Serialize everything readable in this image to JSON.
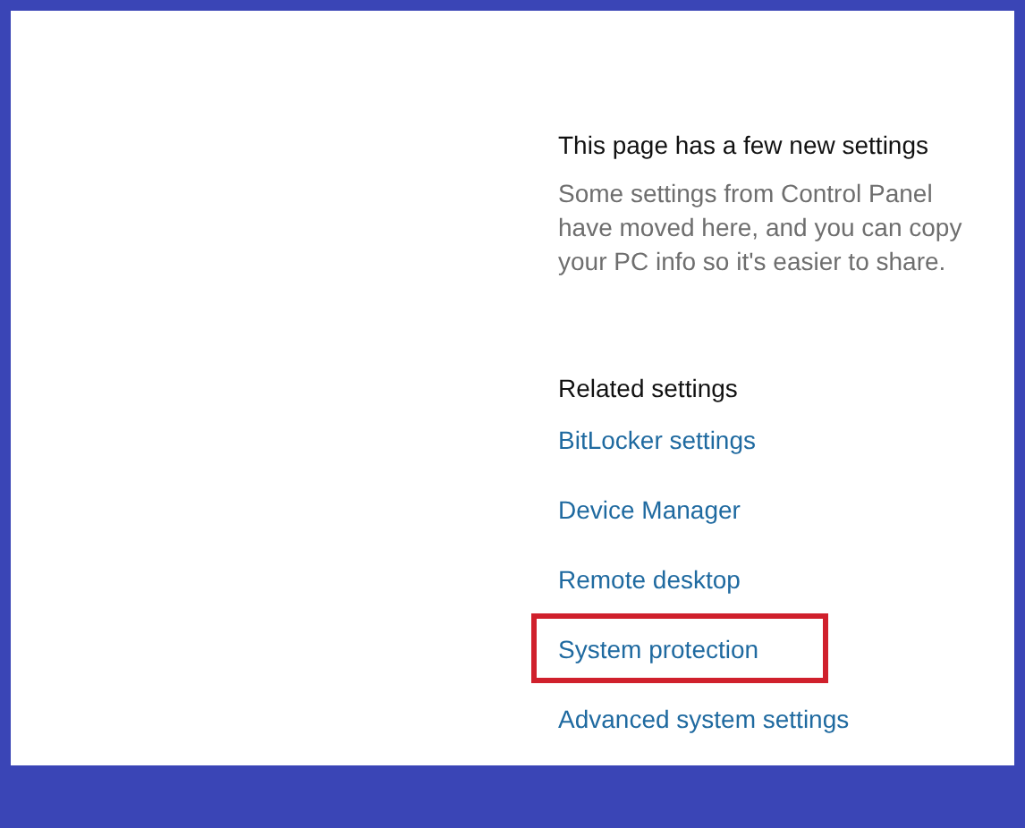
{
  "info": {
    "heading": "This page has a few new settings",
    "description": "Some settings from Control Panel have moved here, and you can copy your PC info so it's easier to share."
  },
  "related_settings": {
    "title": "Related settings",
    "links": [
      {
        "label": "BitLocker settings",
        "highlighted": false
      },
      {
        "label": "Device Manager",
        "highlighted": false
      },
      {
        "label": "Remote desktop",
        "highlighted": false
      },
      {
        "label": "System protection",
        "highlighted": true
      },
      {
        "label": "Advanced system settings",
        "highlighted": false
      }
    ]
  }
}
